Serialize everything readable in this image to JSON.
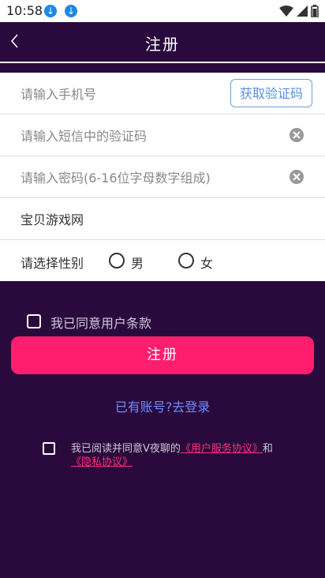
{
  "status_bar": {
    "time": "10:58"
  },
  "header": {
    "title": "注册"
  },
  "form": {
    "phone_placeholder": "请输入手机号",
    "get_code_label": "获取验证码",
    "sms_code_placeholder": "请输入短信中的验证码",
    "password_placeholder": "请输入密码(6-16位字母数字组成)",
    "site_name": "宝贝游戏网",
    "gender_label": "请选择性别",
    "gender_male": "男",
    "gender_female": "女"
  },
  "agree": {
    "terms_text": "我已同意用户条款"
  },
  "register_button": "注册",
  "login_link": "已有账号?去登录",
  "policy": {
    "prefix": "我已阅读并同意V夜聊的",
    "user_agreement": "《用户服务协议》",
    "and": "和",
    "privacy": "《隐私协议》"
  },
  "colors": {
    "background": "#2a0a3d",
    "accent": "#ff1e6e",
    "link": "#6d8cff"
  }
}
